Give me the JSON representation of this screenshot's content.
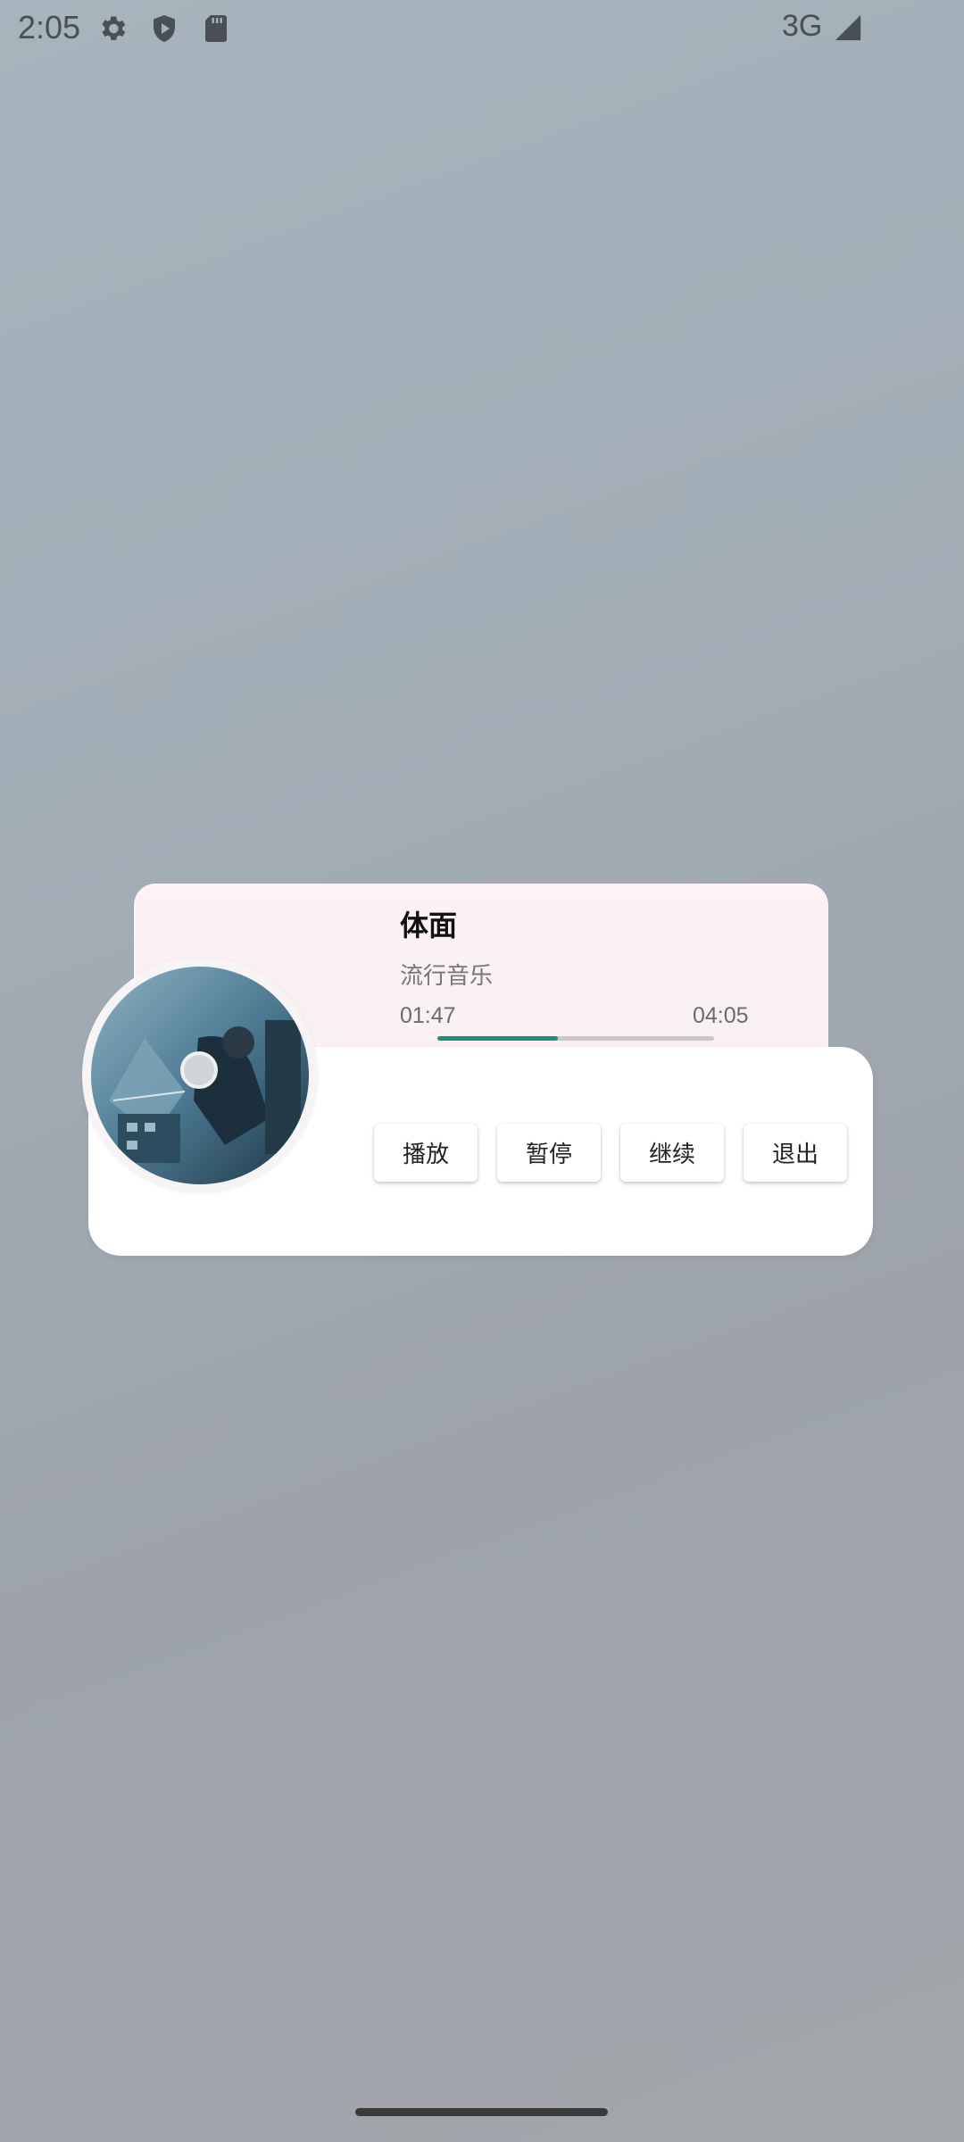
{
  "status_bar": {
    "time": "2:05",
    "network": "3G",
    "icons": [
      "settings-icon",
      "shield-play-icon",
      "sd-card-icon",
      "signal-icon"
    ]
  },
  "player": {
    "title": "体面",
    "genre": "流行音乐",
    "current_time": "01:47",
    "total_time": "04:05",
    "progress_fraction": 0.436,
    "accent_color": "#1a8f7c"
  },
  "controls": {
    "play": "播放",
    "pause": "暂停",
    "resume": "继续",
    "exit": "退出"
  }
}
